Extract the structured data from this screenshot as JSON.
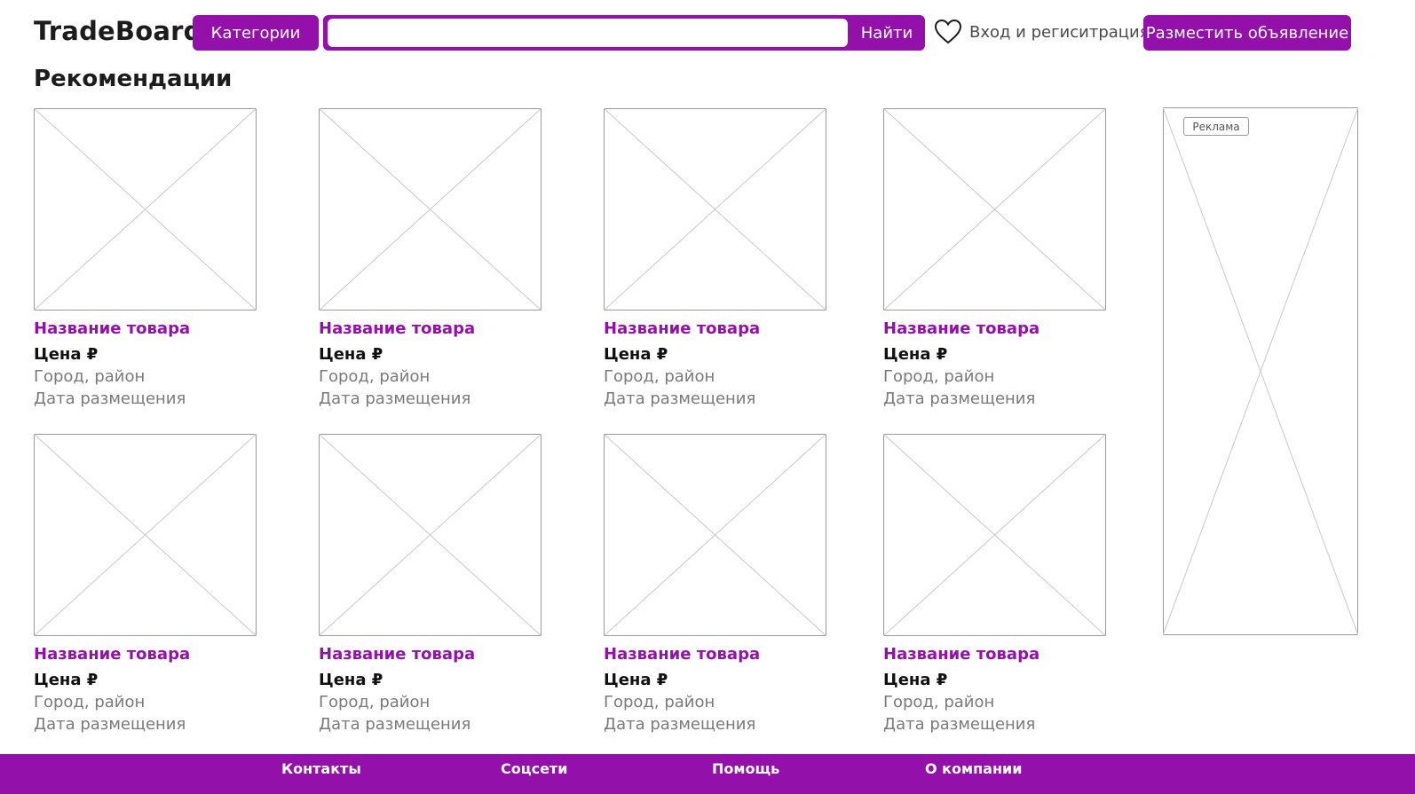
{
  "header": {
    "logo": "TradeBoard",
    "categories_label": "Категории",
    "search": {
      "value": "",
      "placeholder": ""
    },
    "search_button_label": "Найти",
    "favorites_icon": "heart-icon",
    "login_label": "Вход и региситрация",
    "post_ad_label": "Разместить объявление"
  },
  "main": {
    "title": "Рекомендации",
    "cards": [
      {
        "title": "Название товара",
        "price": "Цена ₽",
        "location": "Город, район",
        "date": "Дата размещения"
      },
      {
        "title": "Название товара",
        "price": "Цена ₽",
        "location": "Город, район",
        "date": "Дата размещения"
      },
      {
        "title": "Название товара",
        "price": "Цена ₽",
        "location": "Город, район",
        "date": "Дата размещения"
      },
      {
        "title": "Название товара",
        "price": "Цена ₽",
        "location": "Город, район",
        "date": "Дата размещения"
      },
      {
        "title": "Название товара",
        "price": "Цена ₽",
        "location": "Город, район",
        "date": "Дата размещения"
      },
      {
        "title": "Название товара",
        "price": "Цена ₽",
        "location": "Город, район",
        "date": "Дата размещения"
      },
      {
        "title": "Название товара",
        "price": "Цена ₽",
        "location": "Город, район",
        "date": "Дата размещения"
      },
      {
        "title": "Название товара",
        "price": "Цена ₽",
        "location": "Город, район",
        "date": "Дата размещения"
      }
    ]
  },
  "ad": {
    "label": "Реклама"
  },
  "footer": {
    "links": [
      "Контакты",
      "Соцсети",
      "Помощь",
      "О компании"
    ]
  },
  "colors": {
    "accent": "#9410ab",
    "muted_text": "#7a7a7a",
    "placeholder_stroke": "#c8c8c8",
    "frame_stroke": "#9a9a9a"
  }
}
